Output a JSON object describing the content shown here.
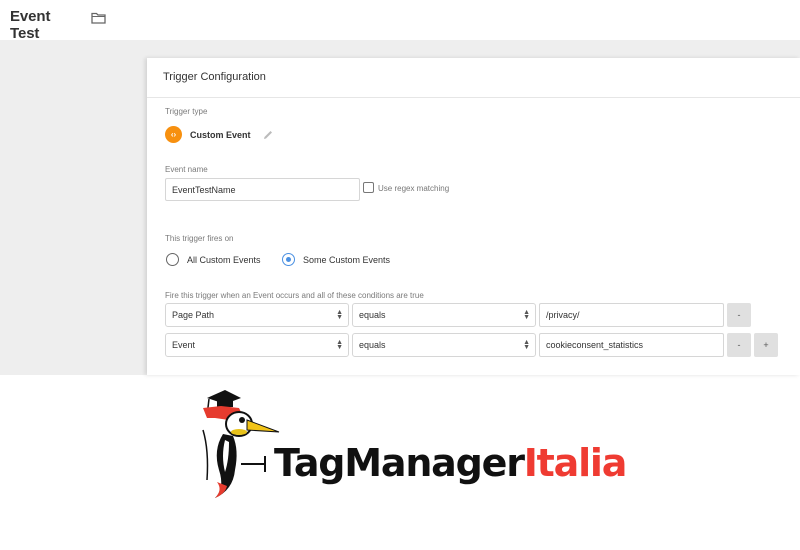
{
  "header": {
    "title": "Event Test",
    "folder_icon": "folder-icon"
  },
  "card": {
    "title": "Trigger Configuration",
    "trigger_type": {
      "label": "Trigger type",
      "name": "Custom Event",
      "icon": "code-brackets-icon",
      "icon_glyph": "‹›",
      "icon_color": "#f7900f",
      "edit_icon": "pencil-icon"
    },
    "event_name": {
      "label": "Event name",
      "value": "EventTestName",
      "regex_label": "Use regex matching",
      "regex_checked": false
    },
    "fires_on": {
      "label": "This trigger fires on",
      "options": [
        {
          "label": "All Custom Events",
          "selected": false
        },
        {
          "label": "Some Custom Events",
          "selected": true
        }
      ]
    },
    "conditions": {
      "label": "Fire this trigger when an Event occurs and all of these conditions are true",
      "rows": [
        {
          "variable": "Page Path",
          "operator": "equals",
          "value": "/privacy/",
          "remove": "-",
          "add": null
        },
        {
          "variable": "Event",
          "operator": "equals",
          "value": "cookieconsent_statistics",
          "remove": "-",
          "add": "+"
        }
      ]
    }
  },
  "branding": {
    "name_main": "TagManager",
    "name_accent": "Italia",
    "accent_color": "#ef3b32",
    "mascot": "woodpecker-mascot-icon"
  }
}
